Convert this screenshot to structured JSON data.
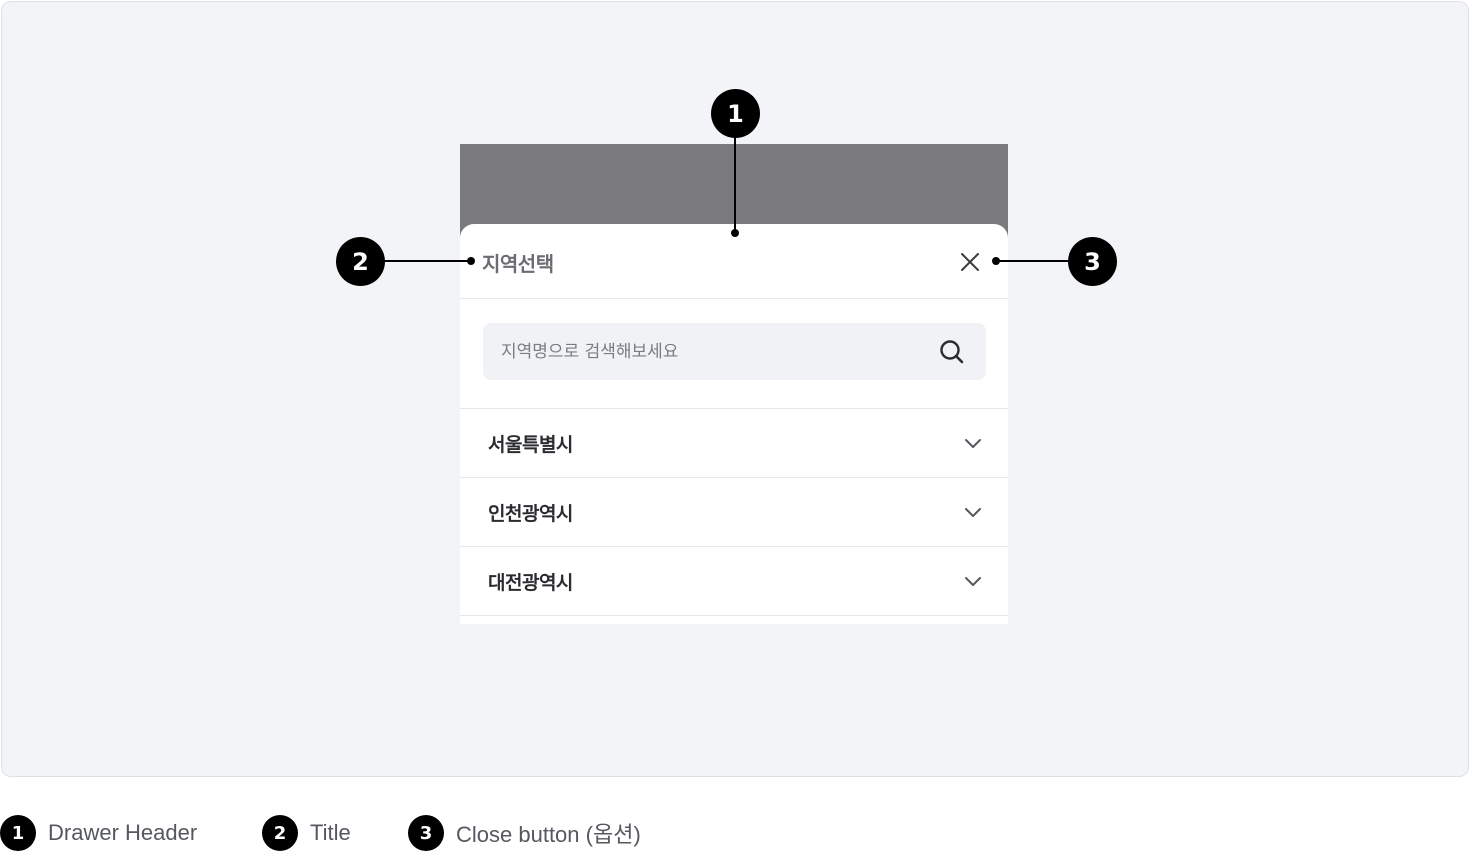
{
  "drawer": {
    "title": "지역선택",
    "search": {
      "placeholder": "지역명으로 검색해보세요",
      "icon": "search-icon"
    },
    "regions": [
      {
        "label": "서울특별시",
        "icon": "chevron-down-icon"
      },
      {
        "label": "인천광역시",
        "icon": "chevron-down-icon"
      },
      {
        "label": "대전광역시",
        "icon": "chevron-down-icon"
      }
    ],
    "close_icon": "close-icon"
  },
  "markers": {
    "m1": "1",
    "m2": "2",
    "m3": "3"
  },
  "legend": [
    {
      "number": "1",
      "label": "Drawer Header"
    },
    {
      "number": "2",
      "label": "Title"
    },
    {
      "number": "3",
      "label": "Close button (옵션)"
    }
  ],
  "colors": {
    "canvas_bg": "#f2f4f8",
    "dim_overlay": "#7a7a7c",
    "marker": "#000000"
  }
}
